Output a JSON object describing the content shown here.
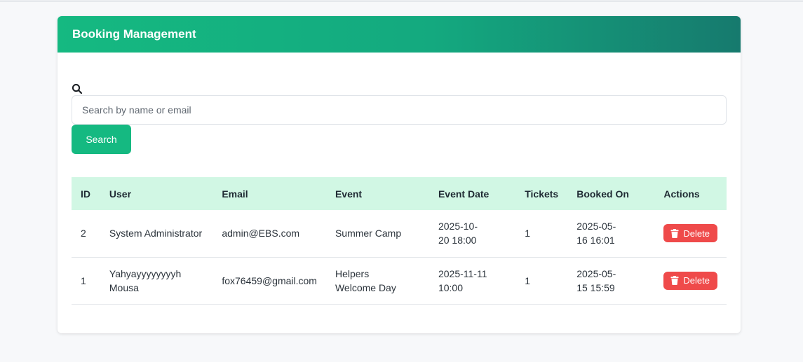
{
  "header": {
    "title": "Booking Management"
  },
  "search": {
    "placeholder": "Search by name or email",
    "value": "",
    "button_label": "Search",
    "icon": "search-icon"
  },
  "table": {
    "columns": [
      "ID",
      "User",
      "Email",
      "Event",
      "Event Date",
      "Tickets",
      "Booked On",
      "Actions"
    ],
    "rows": [
      {
        "id": "2",
        "user": "System Administrator",
        "email": "admin@EBS.com",
        "event": "Summer Camp",
        "event_date": "2025-10-20 18:00",
        "tickets": "1",
        "booked_on": "2025-05-16 16:01",
        "action_label": "Delete"
      },
      {
        "id": "1",
        "user": "Yahyayyyyyyyyh Mousa",
        "email": "fox76459@gmail.com",
        "event": "Helpers Welcome Day",
        "event_date": "2025-11-11 10:00",
        "tickets": "1",
        "booked_on": "2025-05-15 15:59",
        "action_label": "Delete"
      }
    ]
  },
  "colors": {
    "accent": "#15b981",
    "header_gradient_end": "#167a6e",
    "danger": "#ef4a4a",
    "table_header_bg": "#d1f7e4"
  }
}
